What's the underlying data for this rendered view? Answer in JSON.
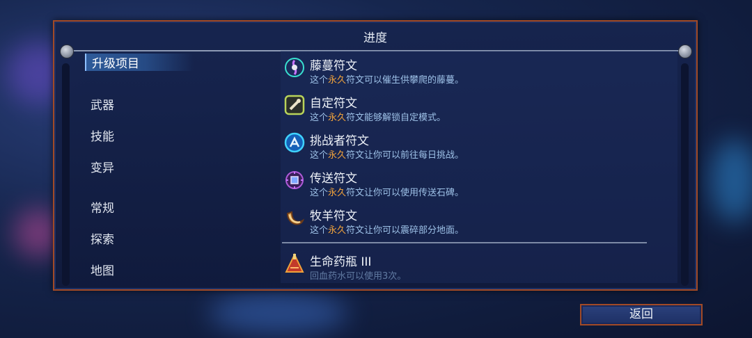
{
  "dialog": {
    "title": "进度",
    "back_label": "返回"
  },
  "categories": [
    {
      "label": "升级项目",
      "active": true
    },
    {
      "label": "武器"
    },
    {
      "label": "技能"
    },
    {
      "label": "变异"
    },
    {
      "label": "常规"
    },
    {
      "label": "探索"
    },
    {
      "label": "地图"
    }
  ],
  "entries": [
    {
      "icon": "vine-rune-icon",
      "name": "藤蔓符文",
      "desc_pre": "这个",
      "desc_hl": "永久",
      "desc_post": "符文可以催生供攀爬的藤蔓。"
    },
    {
      "icon": "custom-rune-icon",
      "name": "自定符文",
      "desc_pre": "这个",
      "desc_hl": "永久",
      "desc_post": "符文能够解锁自定模式。"
    },
    {
      "icon": "challenger-rune-icon",
      "name": "挑战者符文",
      "desc_pre": "这个",
      "desc_hl": "永久",
      "desc_post": "符文让你可以前往每日挑战。"
    },
    {
      "icon": "teleport-rune-icon",
      "name": "传送符文",
      "desc_pre": "这个",
      "desc_hl": "永久",
      "desc_post": "符文让你可以使用传送石碑。"
    },
    {
      "icon": "ram-rune-icon",
      "name": "牧羊符文",
      "desc_pre": "这个",
      "desc_hl": "永久",
      "desc_post": "符文让你可以震碎部分地面。"
    },
    {
      "icon": "health-flask-icon",
      "name": "生命药瓶 III",
      "desc_pre": "回血药水可以使用3次。",
      "desc_hl": "",
      "desc_post": ""
    }
  ],
  "colors": {
    "border": "#a24a26",
    "highlight": "#f0a23b",
    "desc": "#9ec2e8",
    "panel": "#16244e"
  }
}
